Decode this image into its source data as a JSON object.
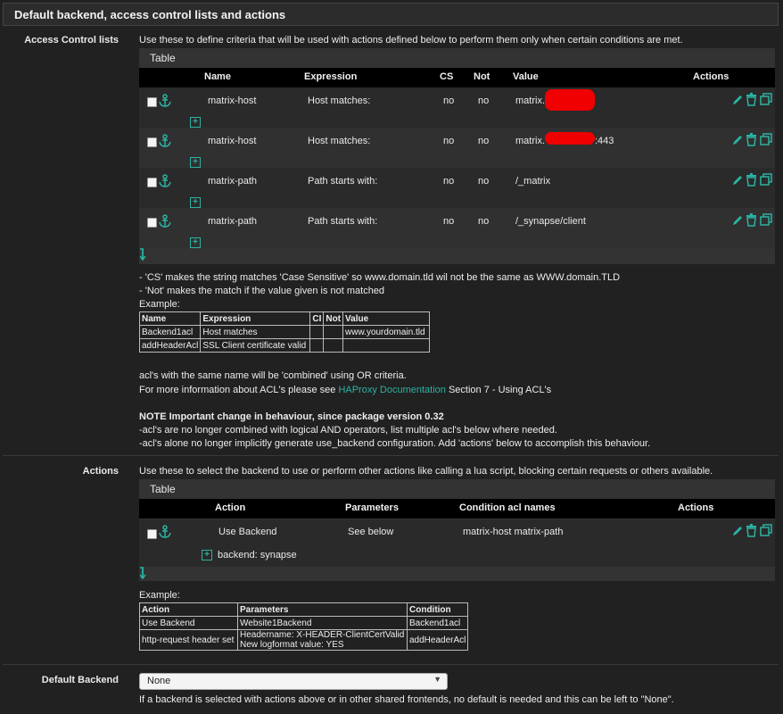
{
  "panel": {
    "title": "Default backend, access control lists and actions"
  },
  "acl": {
    "label": "Access Control lists",
    "description": "Use these to define criteria that will be used with actions defined below to perform them only when certain conditions are met.",
    "table_title": "Table",
    "headers": {
      "name": "Name",
      "expression": "Expression",
      "cs": "CS",
      "not": "Not",
      "value": "Value",
      "actions": "Actions"
    },
    "rows": [
      {
        "name": "matrix-host",
        "expression": "Host matches:",
        "cs": "no",
        "not": "no",
        "value": "matrix.",
        "value_suffix": ""
      },
      {
        "name": "matrix-host",
        "expression": "Host matches:",
        "cs": "no",
        "not": "no",
        "value": "matrix.",
        "value_suffix": ":443"
      },
      {
        "name": "matrix-path",
        "expression": "Path starts with:",
        "cs": "no",
        "not": "no",
        "value": "/_matrix",
        "value_suffix": ""
      },
      {
        "name": "matrix-path",
        "expression": "Path starts with:",
        "cs": "no",
        "not": "no",
        "value": "/_synapse/client",
        "value_suffix": ""
      }
    ],
    "notes": {
      "cs_note": "- 'CS' makes the string matches 'Case Sensitive' so www.domain.tld wil not be the same as WWW.domain.TLD",
      "not_note": "- 'Not' makes the match if the value given is not matched",
      "example_label": "Example:",
      "example_headers": [
        "Name",
        "Expression",
        "CI",
        "Not",
        "Value"
      ],
      "example_rows": [
        [
          "Backend1acl",
          "Host matches",
          "",
          "",
          "www.yourdomain.tld"
        ],
        [
          "addHeaderAcl",
          "SSL Client certificate valid",
          "",
          "",
          ""
        ]
      ],
      "combined": "acl's with the same name will be 'combined' using OR criteria.",
      "more_info_prefix": "For more information about ACL's please see ",
      "more_info_link": "HAProxy Documentation",
      "more_info_suffix": " Section 7 - Using ACL's",
      "note_title": "NOTE Important change in behaviour, since package version 0.32",
      "note_1": "-acl's are no longer combined with logical AND operators, list multiple acl's below where needed.",
      "note_2": "-acl's alone no longer implicitly generate use_backend configuration. Add 'actions' below to accomplish this behaviour."
    }
  },
  "actions": {
    "label": "Actions",
    "description": "Use these to select the backend to use or perform other actions like calling a lua script, blocking certain requests or others available.",
    "table_title": "Table",
    "headers": {
      "action": "Action",
      "parameters": "Parameters",
      "condition": "Condition acl names",
      "actions": "Actions"
    },
    "rows": [
      {
        "action": "Use Backend",
        "parameters": "See below",
        "condition": "matrix-host matrix-path",
        "detail": "backend: synapse"
      }
    ],
    "example_label": "Example:",
    "example_headers": [
      "Action",
      "Parameters",
      "Condition"
    ],
    "example_rows": [
      [
        "Use Backend",
        "Website1Backend",
        "Backend1acl"
      ],
      [
        "http-request header set",
        "Headername: X-HEADER-ClientCertValid",
        "addHeaderAcl"
      ]
    ],
    "example_row2_line2": "New logformat value: YES"
  },
  "default_backend": {
    "label": "Default Backend",
    "selected": "None",
    "help": "If a backend is selected with actions above or in other shared frontends, no default is needed and this can be left to \"None\"."
  },
  "colors": {
    "accent": "#2bb3a3",
    "redaction": "#f00000",
    "background": "#212121"
  },
  "icons": [
    "anchor-icon",
    "pencil-icon",
    "trash-icon",
    "copy-icon",
    "plus-icon",
    "sort-arrow-icon",
    "chevron-down-icon"
  ]
}
